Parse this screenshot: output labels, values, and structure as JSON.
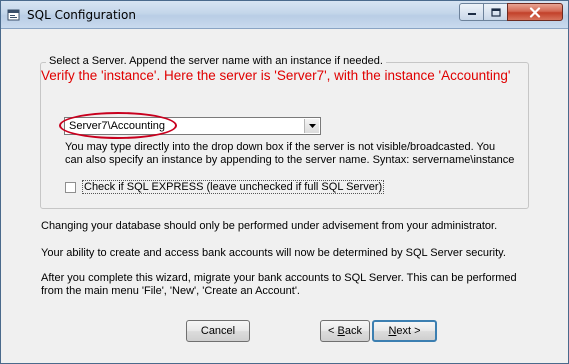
{
  "window": {
    "title": "SQL Configuration"
  },
  "server_group": {
    "label": "Select a Server.  Append the server name with an instance if needed.",
    "annotation": "Verify the 'instance'.  Here the server is 'Server7', with the instance 'Accounting'",
    "combo_value": "Server7\\Accounting",
    "hint_line1": "You may type directly into the drop down box if the server is not visible/broadcasted.  You",
    "hint_line2": "can also specify an instance by appending to the server name.  Syntax: servername\\instance",
    "sql_express_label": "Check if SQL EXPRESS (leave unchecked if full SQL Server)",
    "sql_express_checked": false
  },
  "info": {
    "line1": "Changing your database should only be performed under advisement from your administrator.",
    "line2": "Your ability to create and access bank accounts will now be determined by SQL Server security.",
    "line3a": "After you complete this wizard, migrate your bank accounts to SQL Server.  This can be performed",
    "line3b": "from the main menu 'File', 'New', 'Create an Account'."
  },
  "buttons": {
    "cancel": "Cancel",
    "back_prefix": "< ",
    "back_accel": "B",
    "back_rest": "ack",
    "next_accel": "N",
    "next_rest": "ext >"
  },
  "colors": {
    "annotation": "#e00000",
    "oval": "#c8001e"
  },
  "icons": [
    "window-icon",
    "minimize-icon",
    "maximize-icon",
    "close-icon",
    "dropdown-arrow-icon"
  ]
}
